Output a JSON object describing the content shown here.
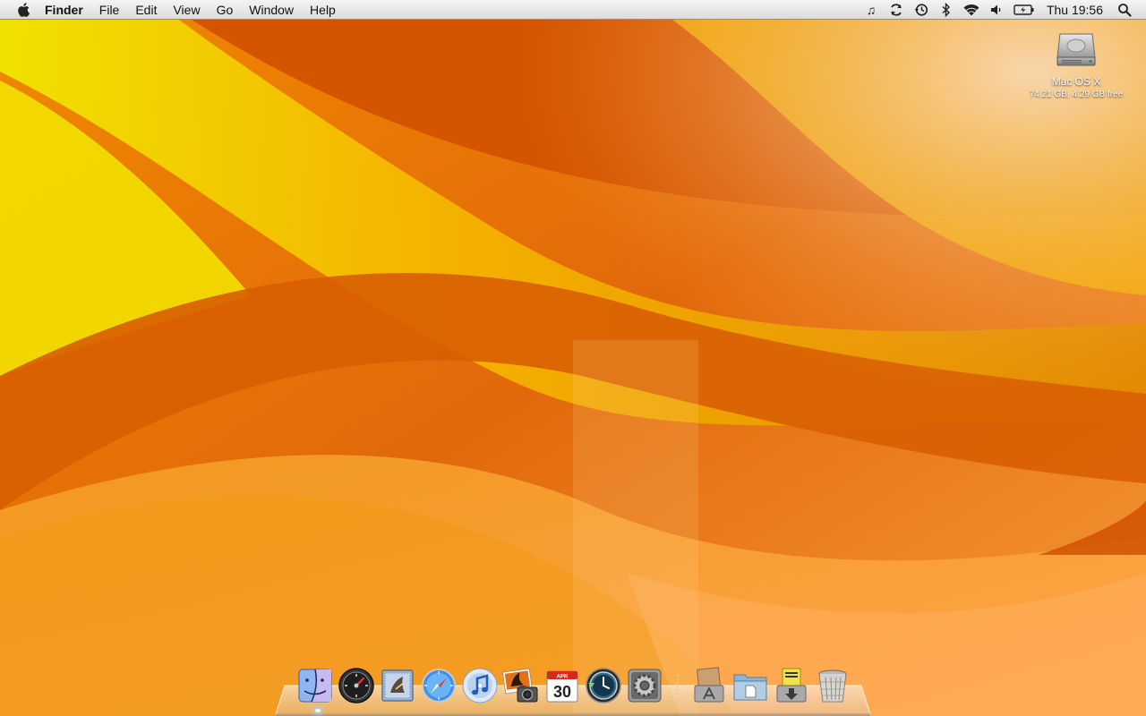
{
  "menubar": {
    "apple_icon": "apple-icon",
    "app_name": "Finder",
    "menus": [
      "File",
      "Edit",
      "View",
      "Go",
      "Window",
      "Help"
    ],
    "status_icons": [
      "itunes-note-icon",
      "sync-icon",
      "time-machine-icon",
      "bluetooth-icon",
      "wifi-icon",
      "volume-icon",
      "battery-icon"
    ],
    "clock": "Thu 19:56",
    "spotlight_icon": "spotlight-search-icon"
  },
  "desktop": {
    "disk": {
      "name": "Mac OS X",
      "info": "74.21 GB, 4.29 GB free",
      "icon": "hard-disk-icon"
    }
  },
  "dock": {
    "apps": [
      {
        "name": "Finder",
        "icon": "finder-icon"
      },
      {
        "name": "Dashboard",
        "icon": "dashboard-icon"
      },
      {
        "name": "Mail",
        "icon": "mail-icon"
      },
      {
        "name": "Safari",
        "icon": "safari-icon"
      },
      {
        "name": "iTunes",
        "icon": "itunes-icon"
      },
      {
        "name": "iPhoto",
        "icon": "iphoto-icon"
      },
      {
        "name": "iCal",
        "icon": "ical-icon",
        "date": "30",
        "month": "APR"
      },
      {
        "name": "Time Machine",
        "icon": "time-machine-icon"
      },
      {
        "name": "System Preferences",
        "icon": "system-preferences-icon"
      }
    ],
    "stacks": [
      {
        "name": "Applications",
        "icon": "applications-stack-icon"
      },
      {
        "name": "Documents",
        "icon": "documents-stack-icon"
      },
      {
        "name": "Downloads",
        "icon": "downloads-stack-icon"
      },
      {
        "name": "Trash",
        "icon": "trash-icon"
      }
    ]
  },
  "colors": {
    "wallpaper_base": "#e86a08",
    "wallpaper_yellow": "#f2c400",
    "wallpaper_light": "#f7b56a",
    "menubar": "#e8e8e8"
  }
}
